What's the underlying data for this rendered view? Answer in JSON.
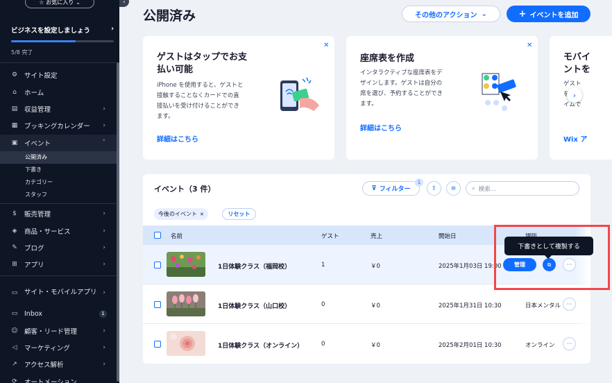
{
  "sidebar": {
    "favorites_label": "お気に入り",
    "setup": {
      "title": "ビジネスを設定しましょう",
      "count": "5/8 完了",
      "progress": 0.625
    },
    "items": [
      {
        "label": "サイト設定",
        "icon": "gear-icon",
        "chevron": false
      },
      {
        "label": "ホーム",
        "icon": "home-icon",
        "chevron": false
      },
      {
        "label": "収益管理",
        "icon": "receipt-icon",
        "chevron": true
      },
      {
        "label": "ブッキングカレンダー",
        "icon": "calendar-icon",
        "chevron": true
      },
      {
        "label": "イベント",
        "icon": "event-icon",
        "chevron": true
      }
    ],
    "event_sub": [
      "公開済み",
      "下書き",
      "カテゴリー",
      "スタッフ"
    ],
    "items2": [
      {
        "label": "販売管理",
        "icon": "dollar-icon"
      },
      {
        "label": "商品・サービス",
        "icon": "box-icon"
      },
      {
        "label": "ブログ",
        "icon": "pen-icon"
      },
      {
        "label": "アプリ",
        "icon": "apps-icon"
      }
    ],
    "items3": [
      {
        "label": "サイト・モバイルアプリ"
      },
      {
        "label": "Inbox",
        "badge": "1"
      },
      {
        "label": "顧客・リード管理"
      },
      {
        "label": "マーケティング"
      },
      {
        "label": "アクセス解析"
      },
      {
        "label": "オートメーション"
      }
    ]
  },
  "header": {
    "title": "公開済み",
    "more_actions": "その他のアクション",
    "add_event": "イベントを追加"
  },
  "cards": [
    {
      "title_line1": "ゲストはタップでお支",
      "title_line2": "払い可能",
      "text": [
        "iPhone を使用すると、ゲストと",
        "接触することなくカードでの直",
        "接払いを受け付けることができ",
        "ます。"
      ],
      "link": "詳細はこちら"
    },
    {
      "title_line1": "座席表を作成",
      "text": [
        "インタラクティブな座席表をデ",
        "ザインします。ゲストは自分の",
        "席を選び、予約することができ",
        "ます。"
      ],
      "link": "詳細はこちら"
    },
    {
      "title_line1": "モバイ",
      "title_line2": "ントを",
      "text": [
        "ゲスト",
        "を「キ",
        "イムで"
      ],
      "link": "Wix ア"
    }
  ],
  "table": {
    "title": "イベント（3 件）",
    "filter_label": "フィルター",
    "filter_count": "1",
    "search_placeholder": "検索...",
    "chip_label": "今後のイベント",
    "reset_label": "リセット",
    "columns": {
      "name": "名前",
      "guests": "ゲスト",
      "sales": "売上",
      "start": "開始日",
      "location": "場所"
    },
    "rows": [
      {
        "name": "1日体験クラス（福岡校）",
        "guests": "1",
        "sales": "￥0",
        "start": "2025年1月03日 19:00",
        "location": ""
      },
      {
        "name": "1日体験クラス（山口校）",
        "guests": "0",
        "sales": "￥0",
        "start": "2025年1月31日 10:30",
        "location": "日本メンタル"
      },
      {
        "name": "1日体験クラス（オンライン）",
        "guests": "0",
        "sales": "￥0",
        "start": "2025年2月01日 10:30",
        "location": "オンライン"
      }
    ],
    "manage_label": "管理",
    "tooltip": "下書きとして複製する"
  }
}
